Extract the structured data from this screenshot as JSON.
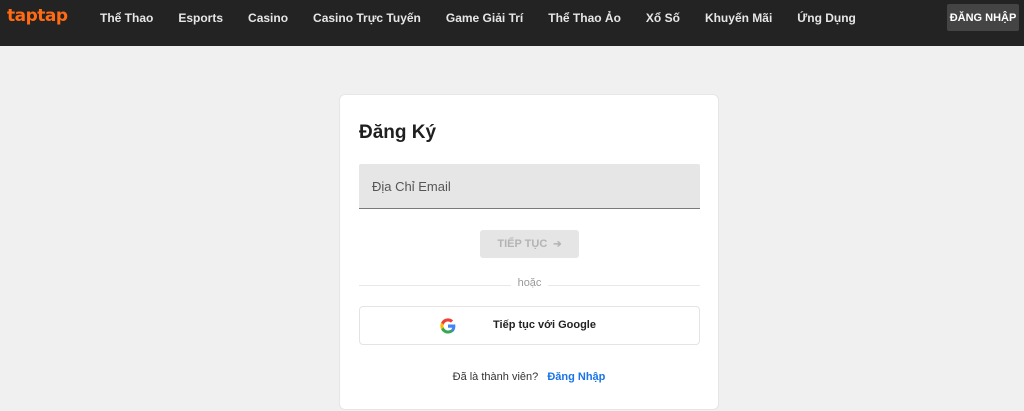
{
  "header": {
    "logo": "taptap",
    "nav": [
      "Thể Thao",
      "Esports",
      "Casino",
      "Casino Trực Tuyến",
      "Game Giải Trí",
      "Thể Thao Ảo",
      "Xổ Số",
      "Khuyến Mãi",
      "Ứng Dụng"
    ],
    "login_label": "ĐĂNG NHẬP"
  },
  "signup": {
    "title": "Đăng Ký",
    "email_placeholder": "Địa Chỉ Email",
    "email_value": "",
    "continue_label": "TIẾP TỤC",
    "continue_icon": "arrow-right",
    "divider_text": "hoặc",
    "google_label": "Tiếp tục với Google",
    "member_text": "Đã là thành viên?",
    "login_link": "Đăng Nhập"
  },
  "colors": {
    "topbar": "#232323",
    "brand": "#ff6a13",
    "link": "#1a73e8",
    "page_bg": "#f0f0f0"
  }
}
